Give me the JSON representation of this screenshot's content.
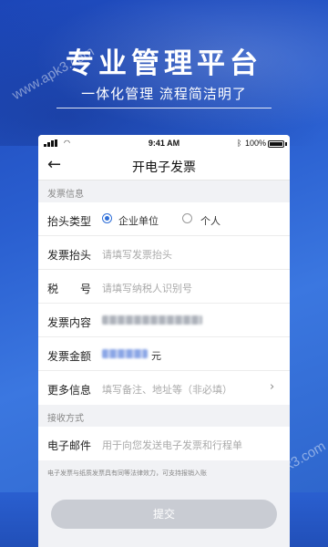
{
  "hero": {
    "title": "专业管理平台",
    "subtitle": "一体化管理 流程简洁明了"
  },
  "watermark": "www.apk3.com",
  "statusbar": {
    "time": "9:41 AM",
    "battery": "100%"
  },
  "nav": {
    "back_icon": "←",
    "title": "开电子发票"
  },
  "invoice_section": {
    "label": "发票信息",
    "header_type": {
      "label": "抬头类型",
      "options": [
        "企业单位",
        "个人"
      ],
      "selected": "企业单位"
    },
    "header": {
      "label": "发票抬头",
      "placeholder": "请填写发票抬头"
    },
    "tax": {
      "label": "税　　号",
      "placeholder": "请填写纳税人识别号"
    },
    "content": {
      "label": "发票内容"
    },
    "amount": {
      "label": "发票金额",
      "unit": "元"
    },
    "more": {
      "label": "更多信息",
      "placeholder": "填写备注、地址等（非必填）",
      "chevron": "›"
    }
  },
  "receive_section": {
    "label": "接收方式",
    "email": {
      "label": "电子邮件",
      "placeholder": "用于向您发送电子发票和行程单"
    }
  },
  "footnote": "电子发票与纸质发票具有同等法律效力，可支持报销入账",
  "submit_label": "提交",
  "colors": {
    "accent": "#2f6fd8",
    "background": "#2a5fd0",
    "submit_disabled": "#c9ccd3"
  }
}
